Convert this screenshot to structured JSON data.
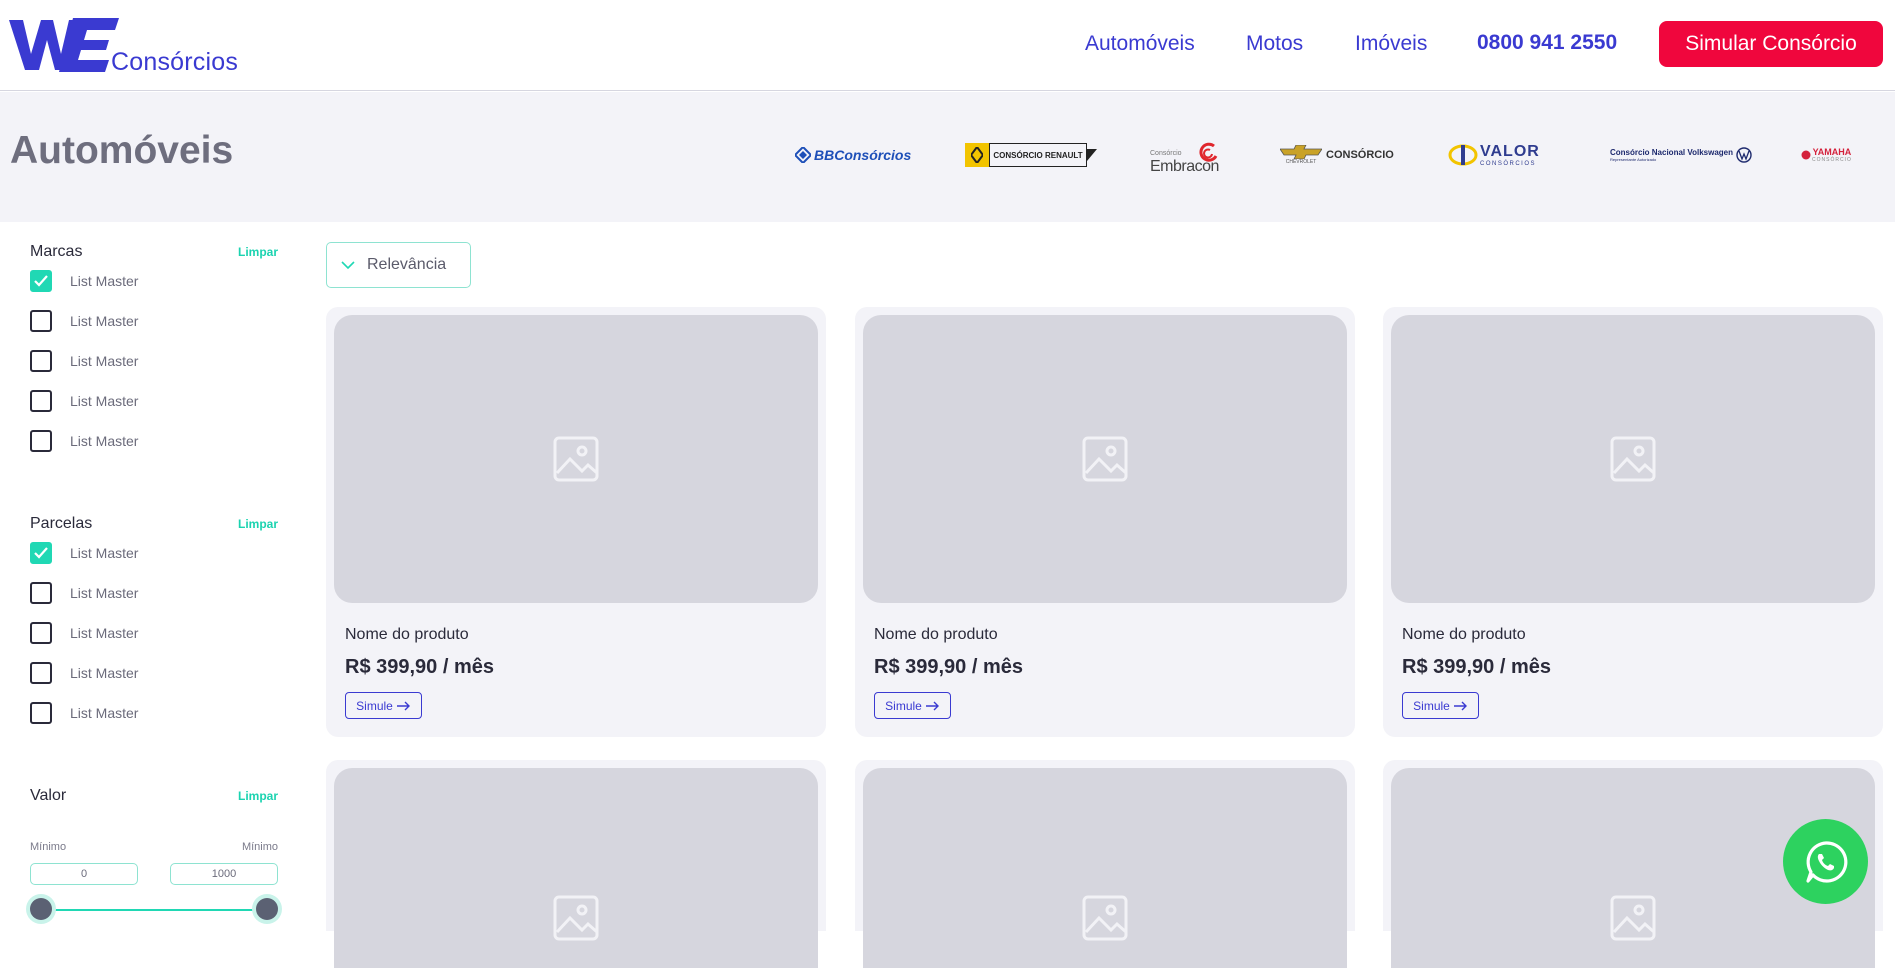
{
  "header": {
    "logo_text": "Consórcios",
    "nav": [
      "Automóveis",
      "Motos",
      "Imóveis"
    ],
    "phone": "0800 941 2550",
    "cta": "Simular Consórcio"
  },
  "band": {
    "title": "Automóveis",
    "brands": [
      {
        "name": "BB Consórcios",
        "label": "BBConsórcios"
      },
      {
        "name": "Consórcio Renault",
        "label": "CONSÓRCIO RENAULT"
      },
      {
        "name": "Consórcio Embracon",
        "label_small": "Consórcio",
        "label": "Embracon"
      },
      {
        "name": "Chevrolet Consórcio",
        "label": "CONSÓRCIO",
        "label_small": "CHEVROLET"
      },
      {
        "name": "Valor Consórcios",
        "label": "VALOR",
        "label_small": "CONSÓRCIOS"
      },
      {
        "name": "Consórcio Nacional Volkswagen",
        "label": "Consórcio Nacional Volkswagen",
        "label_small": "Representante Autorizado"
      },
      {
        "name": "Yamaha Consórcio",
        "label": "YAMAHA",
        "label_small": "CONSÓRCIO"
      }
    ]
  },
  "filters": {
    "marcas": {
      "title": "Marcas",
      "clear": "Limpar",
      "items": [
        {
          "label": "List Master",
          "checked": true
        },
        {
          "label": "List Master",
          "checked": false
        },
        {
          "label": "List Master",
          "checked": false
        },
        {
          "label": "List Master",
          "checked": false
        },
        {
          "label": "List Master",
          "checked": false
        }
      ]
    },
    "parcelas": {
      "title": "Parcelas",
      "clear": "Limpar",
      "items": [
        {
          "label": "List Master",
          "checked": true
        },
        {
          "label": "List Master",
          "checked": false
        },
        {
          "label": "List Master",
          "checked": false
        },
        {
          "label": "List Master",
          "checked": false
        },
        {
          "label": "List Master",
          "checked": false
        }
      ]
    },
    "valor": {
      "title": "Valor",
      "clear": "Limpar",
      "min_label": "Mínimo",
      "max_label": "Mínimo",
      "min_value": "0",
      "max_value": "1000"
    }
  },
  "sort": {
    "label": "Relevância"
  },
  "products": [
    {
      "name": "Nome do produto",
      "price": "R$ 399,90 / mês",
      "button": "Simule"
    },
    {
      "name": "Nome do produto",
      "price": "R$ 399,90 / mês",
      "button": "Simule"
    },
    {
      "name": "Nome do produto",
      "price": "R$ 399,90 / mês",
      "button": "Simule"
    },
    {
      "name": "",
      "price": "",
      "button": ""
    },
    {
      "name": "",
      "price": "",
      "button": ""
    },
    {
      "name": "",
      "price": "",
      "button": ""
    }
  ],
  "colors": {
    "brand_blue": "#3a3ad1",
    "cta_red": "#f0063d",
    "accent_teal": "#20d8b4",
    "whatsapp_green": "#2dd25f"
  }
}
